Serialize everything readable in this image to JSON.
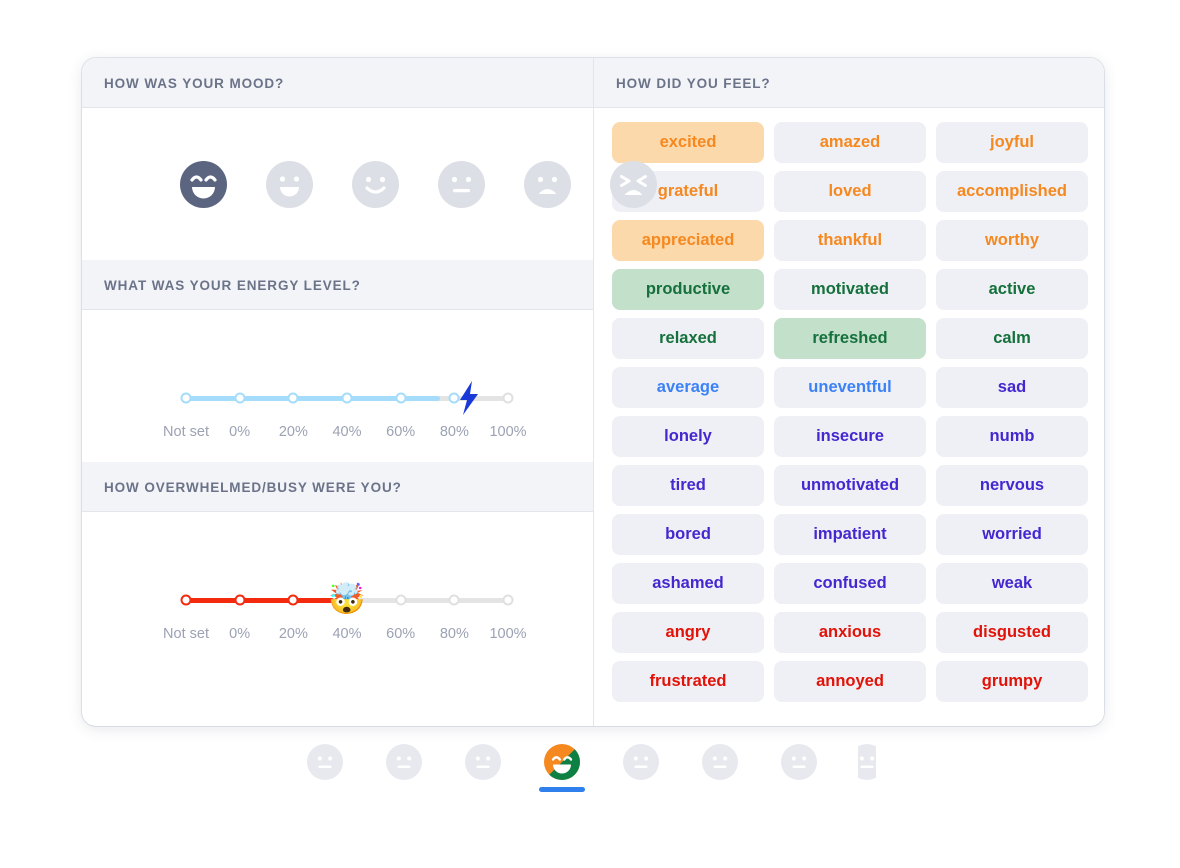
{
  "mood_section": {
    "title": "HOW WAS YOUR MOOD?",
    "selected_index": 0,
    "faces": [
      {
        "name": "face-laughing",
        "expression": "laughing",
        "selected": true
      },
      {
        "name": "face-grin",
        "expression": "grin",
        "selected": false
      },
      {
        "name": "face-smile",
        "expression": "smile",
        "selected": false
      },
      {
        "name": "face-neutral",
        "expression": "neutral",
        "selected": false
      },
      {
        "name": "face-frown",
        "expression": "frown",
        "selected": false
      },
      {
        "name": "face-distressed",
        "expression": "distressed",
        "selected": false
      }
    ]
  },
  "energy_section": {
    "title": "WHAT WAS YOUR ENERGY LEVEL?",
    "ticks": [
      "Not set",
      "0%",
      "20%",
      "40%",
      "60%",
      "80%",
      "100%"
    ],
    "value": "80%",
    "value_index": 5,
    "thumb_icon": "lightning-bolt-icon",
    "fill_color": "#a5dcfb",
    "thumb_color": "#1a39d6"
  },
  "overwhelm_section": {
    "title": "HOW OVERWHELMED/BUSY WERE YOU?",
    "ticks": [
      "Not set",
      "0%",
      "20%",
      "40%",
      "60%",
      "80%",
      "100%"
    ],
    "value": "40%",
    "value_index": 3,
    "thumb_icon": "exploding-head-emoji",
    "thumb_glyph": "🤯",
    "fill_color": "#f42a0f"
  },
  "feelings_section": {
    "title": "HOW DID YOU FEEL?",
    "tags": [
      {
        "label": "excited",
        "color": "orange",
        "selected": true
      },
      {
        "label": "amazed",
        "color": "orange",
        "selected": false
      },
      {
        "label": "joyful",
        "color": "orange",
        "selected": false
      },
      {
        "label": "grateful",
        "color": "orange",
        "selected": false
      },
      {
        "label": "loved",
        "color": "orange",
        "selected": false
      },
      {
        "label": "accomplished",
        "color": "orange",
        "selected": false
      },
      {
        "label": "appreciated",
        "color": "orange",
        "selected": true
      },
      {
        "label": "thankful",
        "color": "orange",
        "selected": false
      },
      {
        "label": "worthy",
        "color": "orange",
        "selected": false
      },
      {
        "label": "productive",
        "color": "green",
        "selected": true
      },
      {
        "label": "motivated",
        "color": "green",
        "selected": false
      },
      {
        "label": "active",
        "color": "green",
        "selected": false
      },
      {
        "label": "relaxed",
        "color": "green",
        "selected": false
      },
      {
        "label": "refreshed",
        "color": "green",
        "selected": true
      },
      {
        "label": "calm",
        "color": "green",
        "selected": false
      },
      {
        "label": "average",
        "color": "blue",
        "selected": false
      },
      {
        "label": "uneventful",
        "color": "blue",
        "selected": false
      },
      {
        "label": "sad",
        "color": "purple",
        "selected": false
      },
      {
        "label": "lonely",
        "color": "purple",
        "selected": false
      },
      {
        "label": "insecure",
        "color": "purple",
        "selected": false
      },
      {
        "label": "numb",
        "color": "purple",
        "selected": false
      },
      {
        "label": "tired",
        "color": "purple",
        "selected": false
      },
      {
        "label": "unmotivated",
        "color": "purple",
        "selected": false
      },
      {
        "label": "nervous",
        "color": "purple",
        "selected": false
      },
      {
        "label": "bored",
        "color": "purple",
        "selected": false
      },
      {
        "label": "impatient",
        "color": "purple",
        "selected": false
      },
      {
        "label": "worried",
        "color": "purple",
        "selected": false
      },
      {
        "label": "ashamed",
        "color": "purple",
        "selected": false
      },
      {
        "label": "confused",
        "color": "purple",
        "selected": false
      },
      {
        "label": "weak",
        "color": "purple",
        "selected": false
      },
      {
        "label": "angry",
        "color": "red",
        "selected": false
      },
      {
        "label": "anxious",
        "color": "red",
        "selected": false
      },
      {
        "label": "disgusted",
        "color": "red",
        "selected": false
      },
      {
        "label": "frustrated",
        "color": "red",
        "selected": false
      },
      {
        "label": "annoyed",
        "color": "red",
        "selected": false
      },
      {
        "label": "grumpy",
        "color": "red",
        "selected": false
      }
    ]
  },
  "bottom_nav": {
    "active_index": 3,
    "items": [
      {
        "name": "nav-face-1",
        "active": false
      },
      {
        "name": "nav-face-2",
        "active": false
      },
      {
        "name": "nav-face-3",
        "active": false
      },
      {
        "name": "nav-face-active",
        "active": true
      },
      {
        "name": "nav-face-5",
        "active": false
      },
      {
        "name": "nav-face-6",
        "active": false
      },
      {
        "name": "nav-face-7",
        "active": false
      },
      {
        "name": "nav-face-8-partial",
        "active": false
      }
    ]
  },
  "colors": {
    "orange": "#f5881f",
    "orange_bg": "#fcd9ab",
    "green": "#15703c",
    "green_bg": "#c3e0cb",
    "blue": "#3b82f6",
    "purple": "#4527d0",
    "red": "#e11208",
    "tag_bg": "#eff0f5",
    "header_bg": "#f3f4f8",
    "header_text": "#6b7389",
    "accent": "#2f80ed"
  }
}
